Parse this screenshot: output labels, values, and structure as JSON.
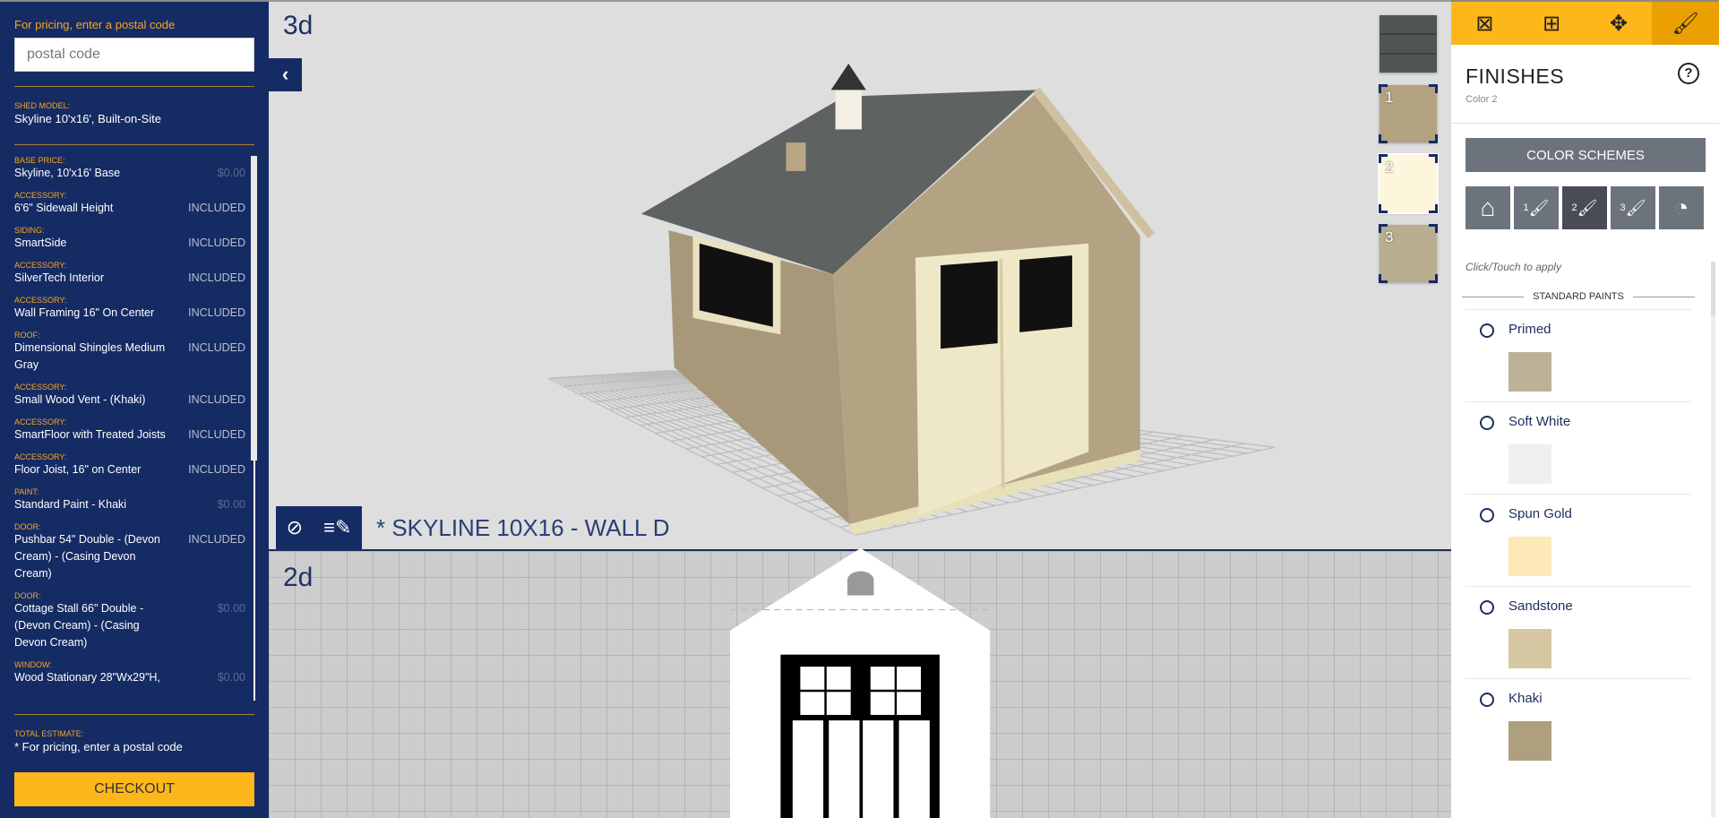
{
  "pricing": {
    "label": "For pricing, enter a postal code",
    "placeholder": "postal code"
  },
  "shed_model": {
    "label": "SHED MODEL:",
    "value": "Skyline 10'x16', Built-on-Site"
  },
  "items": [
    {
      "category": "BASE PRICE:",
      "name": "Skyline, 10'x16' Base",
      "price": "$0.00"
    },
    {
      "category": "ACCESSORY:",
      "name": "6'6\" Sidewall Height",
      "price": "INCLUDED"
    },
    {
      "category": "SIDING:",
      "name": "SmartSide",
      "price": "INCLUDED"
    },
    {
      "category": "ACCESSORY:",
      "name": "SilverTech Interior",
      "price": "INCLUDED"
    },
    {
      "category": "ACCESSORY:",
      "name": "Wall Framing 16\" On Center",
      "price": "INCLUDED"
    },
    {
      "category": "ROOF:",
      "name": "Dimensional Shingles Medium Gray",
      "price": "INCLUDED"
    },
    {
      "category": "ACCESSORY:",
      "name": "Small Wood Vent - (Khaki)",
      "price": "INCLUDED"
    },
    {
      "category": "ACCESSORY:",
      "name": "SmartFloor with Treated Joists",
      "price": "INCLUDED"
    },
    {
      "category": "ACCESSORY:",
      "name": "Floor Joist, 16\" on Center",
      "price": "INCLUDED"
    },
    {
      "category": "PAINT:",
      "name": "Standard Paint - Khaki",
      "price": "$0.00"
    },
    {
      "category": "DOOR:",
      "name": "Pushbar 54\" Double - (Devon Cream) - (Casing Devon Cream)",
      "price": "INCLUDED"
    },
    {
      "category": "DOOR:",
      "name": "Cottage Stall 66\" Double - (Devon Cream) - (Casing Devon Cream)",
      "price": "$0.00"
    },
    {
      "category": "WINDOW:",
      "name": "Wood Stationary 28\"Wx29\"H,",
      "price": "$0.00"
    }
  ],
  "total": {
    "label": "TOTAL ESTIMATE:",
    "value": "* For pricing, enter a postal code"
  },
  "checkout_label": "CHECKOUT",
  "view3d": {
    "label": "3d",
    "title": "* SKYLINE 10X16 - WALL D"
  },
  "view2d": {
    "label": "2d"
  },
  "color_slots": [
    {
      "n": "1",
      "color": "#b3a27f"
    },
    {
      "n": "2",
      "color": "#fdf6dc"
    },
    {
      "n": "3",
      "color": "#b9ad8f"
    }
  ],
  "roof_swatch_color": "#4f5554",
  "right": {
    "tabs": [
      "doors-windows-icon",
      "window-icon",
      "weathervane-icon",
      "paintbrush-icon"
    ],
    "active_tab": 3,
    "title": "FINISHES",
    "subtitle": "Color 2",
    "color_schemes": "COLOR SCHEMES",
    "icon_buttons": [
      "house-icon",
      "1",
      "2",
      "3",
      "swatch-fan-icon"
    ],
    "active_icon_button": 2,
    "hint": "Click/Touch to apply",
    "section": "STANDARD PAINTS",
    "paints": [
      {
        "name": "Primed",
        "color": "#bdb198"
      },
      {
        "name": "Soft White",
        "color": "#efefef"
      },
      {
        "name": "Spun Gold",
        "color": "#fde8b8"
      },
      {
        "name": "Sandstone",
        "color": "#d4c7a1"
      },
      {
        "name": "Khaki",
        "color": "#ae9f7f"
      }
    ]
  },
  "colors": {
    "navy": "#152b64",
    "accent": "#fdb71a",
    "label_orange": "#f6a623"
  }
}
